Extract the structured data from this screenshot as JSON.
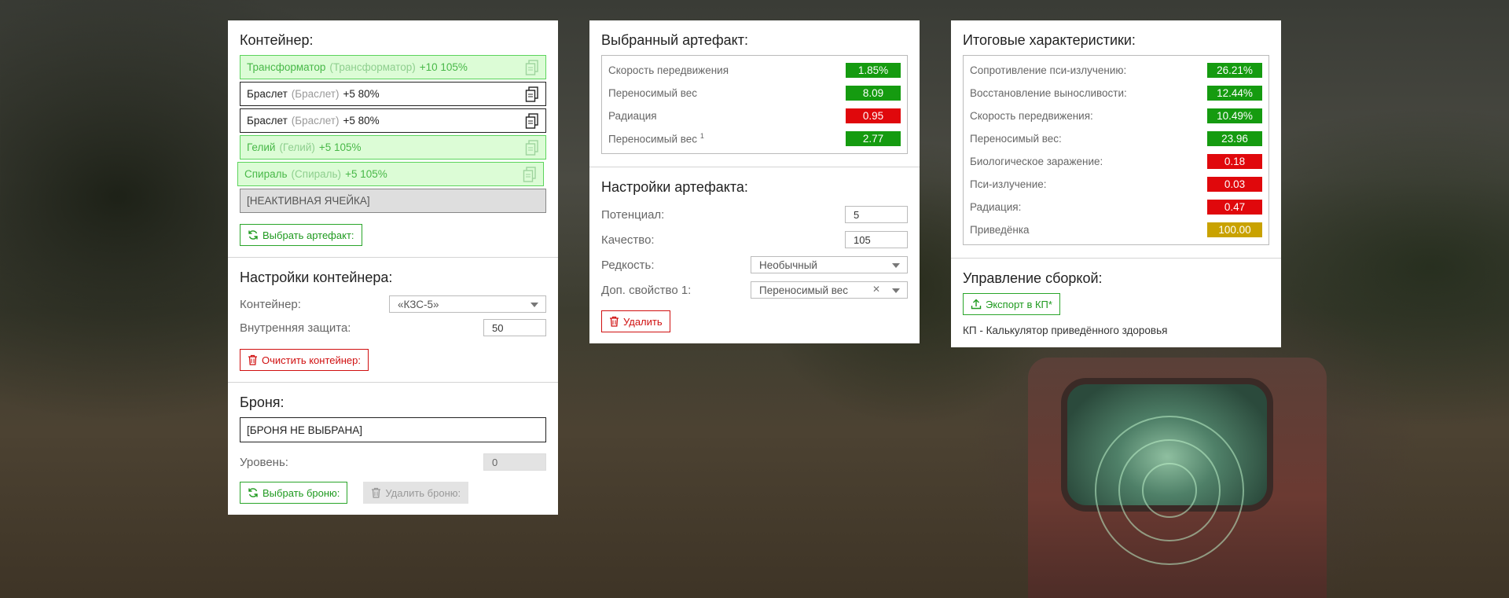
{
  "container_panel": {
    "title": "Контейнер:",
    "slots": [
      {
        "name": "Трансформатор",
        "orig": "(Трансформатор)",
        "suffix": "+10 105%"
      },
      {
        "name": "Браслет",
        "orig": "(Браслет)",
        "suffix": "+5 80%"
      },
      {
        "name": "Браслет",
        "orig": "(Браслет)",
        "suffix": "+5 80%"
      },
      {
        "name": "Гелий",
        "orig": "(Гелий)",
        "suffix": "+5 105%"
      },
      {
        "name": "Спираль",
        "orig": "(Спираль)",
        "suffix": "+5 105%"
      },
      {
        "name": "[НЕАКТИВНАЯ ЯЧЕЙКА]"
      }
    ],
    "choose_artifact_label": "Выбрать артефакт:",
    "settings_title": "Настройки контейнера:",
    "container_label": "Контейнер:",
    "container_value": "«КЗС-5»",
    "protection_label": "Внутренняя защита:",
    "protection_value": "50",
    "clear_label": "Очистить контейнер:",
    "armor_title": "Броня:",
    "armor_value": "[БРОНЯ НЕ ВЫБРАНА]",
    "level_label": "Уровень:",
    "level_value": "0",
    "choose_armor_label": "Выбрать броню:",
    "remove_armor_label": "Удалить броню:"
  },
  "artifact_panel": {
    "title": "Выбранный артефакт:",
    "stats": [
      {
        "label": "Скорость передвижения",
        "value": "1.85%",
        "kind": "pos"
      },
      {
        "label": "Переносимый вес",
        "value": "8.09",
        "kind": "pos"
      },
      {
        "label": "Радиация",
        "value": "0.95",
        "kind": "neg"
      },
      {
        "label": "Переносимый вес",
        "sup": "1",
        "value": "2.77",
        "kind": "pos"
      }
    ],
    "settings_title": "Настройки артефакта:",
    "potential_label": "Потенциал:",
    "potential_value": "5",
    "quality_label": "Качество:",
    "quality_value": "105",
    "rarity_label": "Редкость:",
    "rarity_value": "Необычный",
    "extra_label": "Доп. свойство 1:",
    "extra_value": "Переносимый вес",
    "delete_label": "Удалить"
  },
  "summary_panel": {
    "title": "Итоговые характеристики:",
    "stats": [
      {
        "label": "Сопротивление пси-излучению:",
        "value": "26.21%",
        "kind": "pos"
      },
      {
        "label": "Восстановление выносливости:",
        "value": "12.44%",
        "kind": "pos"
      },
      {
        "label": "Скорость передвижения:",
        "value": "10.49%",
        "kind": "pos"
      },
      {
        "label": "Переносимый вес:",
        "value": "23.96",
        "kind": "pos"
      },
      {
        "label": "Биологическое заражение:",
        "value": "0.18",
        "kind": "neg"
      },
      {
        "label": "Пси-излучение:",
        "value": "0.03",
        "kind": "neg"
      },
      {
        "label": "Радиация:",
        "value": "0.47",
        "kind": "neg"
      },
      {
        "label": "Приведёнка",
        "value": "100.00",
        "kind": "neutral"
      }
    ],
    "build_title": "Управление сборкой:",
    "export_label": "Экспорт в КП*",
    "note": "КП - Калькулятор приведённого здоровья"
  },
  "icons": {
    "copy": "copy-icon",
    "refresh": "refresh-icon",
    "trash": "trash-icon",
    "upload": "upload-icon",
    "caret": "caret-down-icon",
    "clear": "clear-icon"
  },
  "colors": {
    "positive": "#159b10",
    "negative": "#e0080c",
    "neutral": "#c9a200",
    "accent_green": "#2aa52a",
    "danger_red": "#d01010",
    "active_slot_bg": "#dcfcd6"
  }
}
